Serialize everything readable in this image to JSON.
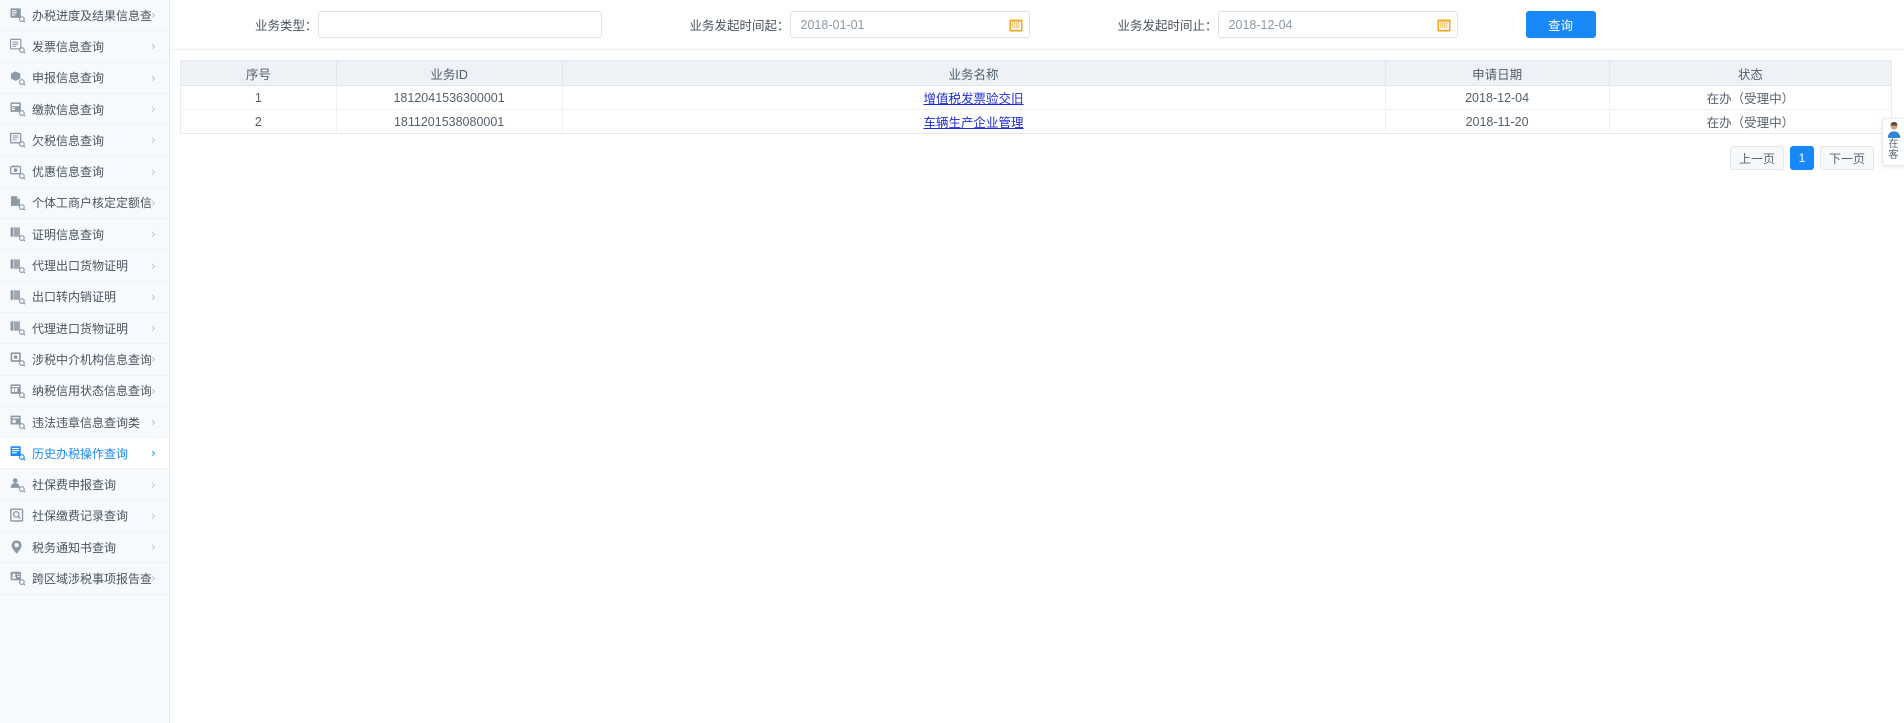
{
  "sidebar": {
    "items": [
      {
        "label": "办税进度及结果信息查询",
        "icon": "doc-search-icon",
        "active": false
      },
      {
        "label": "发票信息查询",
        "icon": "invoice-search-icon",
        "active": false
      },
      {
        "label": "申报信息查询",
        "icon": "box-search-icon",
        "active": false
      },
      {
        "label": "缴款信息查询",
        "icon": "payment-search-icon",
        "active": false
      },
      {
        "label": "欠税信息查询",
        "icon": "arrears-search-icon",
        "active": false
      },
      {
        "label": "优惠信息查询",
        "icon": "benefit-search-icon",
        "active": false
      },
      {
        "label": "个体工商户核定定额信息查询",
        "icon": "file-search-icon",
        "active": false
      },
      {
        "label": "证明信息查询",
        "icon": "certificate-search-icon",
        "active": false
      },
      {
        "label": "代理出口货物证明",
        "icon": "certificate-search-icon",
        "active": false
      },
      {
        "label": "出口转内销证明",
        "icon": "certificate-search-icon",
        "active": false
      },
      {
        "label": "代理进口货物证明",
        "icon": "certificate-search-icon",
        "active": false
      },
      {
        "label": "涉税中介机构信息查询",
        "icon": "agency-search-icon",
        "active": false
      },
      {
        "label": "纳税信用状态信息查询",
        "icon": "credit-search-icon",
        "active": false
      },
      {
        "label": "违法违章信息查询类",
        "icon": "violation-search-icon",
        "active": false
      },
      {
        "label": "历史办税操作查询",
        "icon": "history-search-icon",
        "active": true
      },
      {
        "label": "社保费申报查询",
        "icon": "person-search-icon",
        "active": false
      },
      {
        "label": "社保缴费记录查询",
        "icon": "magnifier-icon",
        "active": false
      },
      {
        "label": "税务通知书查询",
        "icon": "location-pin-icon",
        "active": false
      },
      {
        "label": "跨区域涉税事项报告查询",
        "icon": "id-card-search-icon",
        "active": false
      }
    ],
    "arrow_glyph": "›"
  },
  "query_form": {
    "biz_type": {
      "label": "业务类型：",
      "value": "",
      "placeholder": ""
    },
    "date_from": {
      "label": "业务发起时间起：",
      "value": "2018-01-01",
      "placeholder": "",
      "icon": "calendar-icon"
    },
    "date_to": {
      "label": "业务发起时间止：",
      "value": "2018-12-04",
      "placeholder": "",
      "icon": "calendar-icon"
    },
    "search_button": "查询",
    "accent_color": "#1989fa",
    "calendar_icon_color": "#f5a623"
  },
  "table": {
    "columns": [
      "序号",
      "业务ID",
      "业务名称",
      "申请日期",
      "状态"
    ],
    "rows": [
      {
        "seq": "1",
        "biz_id": "1812041536300001",
        "biz_name": "增值税发票验交旧",
        "apply_date": "2018-12-04",
        "status": "在办（受理中）"
      },
      {
        "seq": "2",
        "biz_id": "1811201538080001",
        "biz_name": "车辆生产企业管理",
        "apply_date": "2018-11-20",
        "status": "在办（受理中）"
      }
    ],
    "link_color": "#1d2dd8"
  },
  "pagination": {
    "prev_label": "上一页",
    "current_page": "1",
    "next_label": "下一页"
  },
  "service_widget": {
    "line1": "在",
    "line2": "客",
    "icon": "online-service-avatar-icon"
  }
}
